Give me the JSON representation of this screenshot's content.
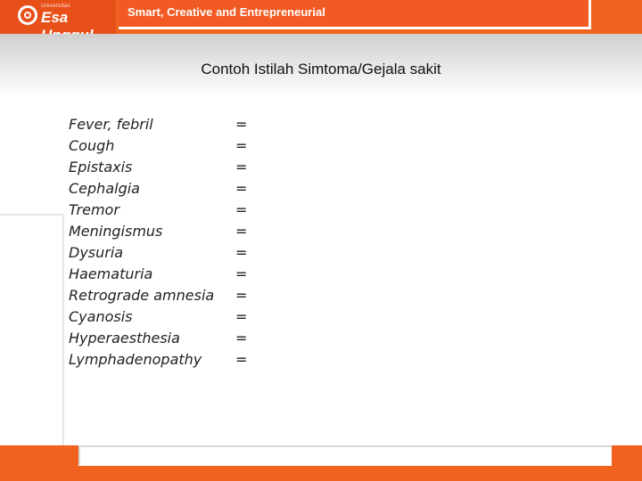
{
  "header": {
    "logo_small": "Universitas",
    "logo_name": "Esa Unggul",
    "tagline": "Smart, Creative and Entrepreneurial"
  },
  "slide": {
    "title": "Contoh Istilah Simtoma/Gejala sakit",
    "terms": [
      "Fever, febril",
      "Cough",
      "Epistaxis",
      "Cephalgia",
      "Tremor",
      "Meningismus",
      "Dysuria",
      "Haematuria",
      "Retrograde amnesia",
      "Cyanosis",
      "Hyperaesthesia",
      "Lymphadenopathy"
    ],
    "separator": "="
  },
  "colors": {
    "brand_orange": "#f0621e"
  }
}
